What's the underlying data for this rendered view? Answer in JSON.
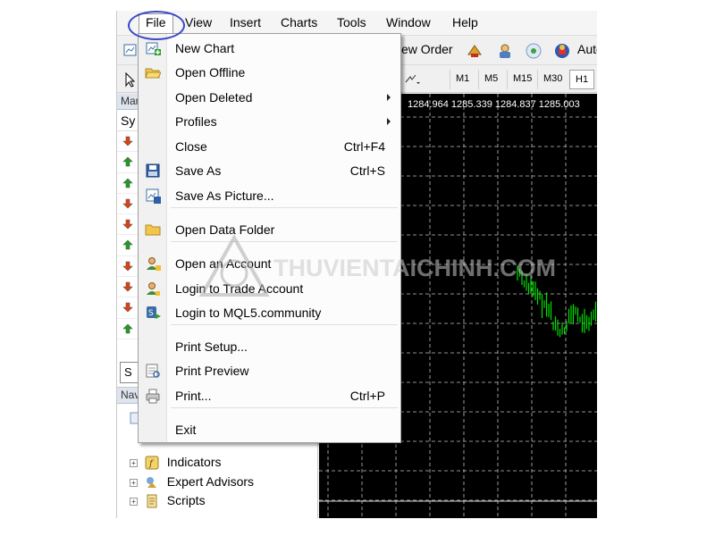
{
  "menubar": {
    "items": [
      "File",
      "View",
      "Insert",
      "Charts",
      "Tools",
      "Window",
      "Help"
    ]
  },
  "toolbar": {
    "new_order_label": "ew Order",
    "auto_label": "Auto",
    "timeframes": [
      "M1",
      "M5",
      "M15",
      "M30",
      "H1"
    ]
  },
  "market_watch": {
    "header": "Mar",
    "column_symbol": "Sy",
    "tab_label": "S",
    "arrows": [
      "down",
      "up",
      "up",
      "down",
      "down",
      "up",
      "down",
      "down",
      "down",
      "up"
    ]
  },
  "navigator": {
    "header": "Nav",
    "items": [
      "Indicators",
      "Expert Advisors",
      "Scripts"
    ]
  },
  "chart": {
    "quote_values": "1284.964 1285.339 1284.837 1285.003",
    "background": "#000000",
    "candle_color": "#00e000",
    "grid_color": "#c0c0c0"
  },
  "file_menu": {
    "items": [
      {
        "label": "New Chart",
        "icon": "new-chart-icon"
      },
      {
        "label": "Open Offline",
        "icon": "folder-open-icon"
      },
      {
        "label": "Open Deleted",
        "submenu": true
      },
      {
        "label": "Profiles",
        "submenu": true
      },
      {
        "label": "Close",
        "shortcut": "Ctrl+F4"
      },
      {
        "label": "Save As",
        "shortcut": "Ctrl+S",
        "icon": "floppy-disk-icon"
      },
      {
        "label": "Save As Picture...",
        "icon": "save-picture-icon"
      },
      {
        "label": "Open Data Folder",
        "icon": "folder-icon"
      },
      {
        "label": "Open an Account",
        "icon": "add-user-icon"
      },
      {
        "label": "Login to Trade Account",
        "icon": "user-login-icon"
      },
      {
        "label": "Login to MQL5.community",
        "icon": "mql5-login-icon"
      },
      {
        "label": "Print Setup..."
      },
      {
        "label": "Print Preview",
        "icon": "print-preview-icon"
      },
      {
        "label": "Print...",
        "shortcut": "Ctrl+P",
        "icon": "printer-icon"
      },
      {
        "label": "Exit"
      }
    ]
  },
  "watermark": "THUVIENTAICHINH.COM",
  "colors": {
    "highlight_ring": "#3a48c8",
    "arrow_up": "#1aa01a",
    "arrow_down": "#e04010"
  }
}
